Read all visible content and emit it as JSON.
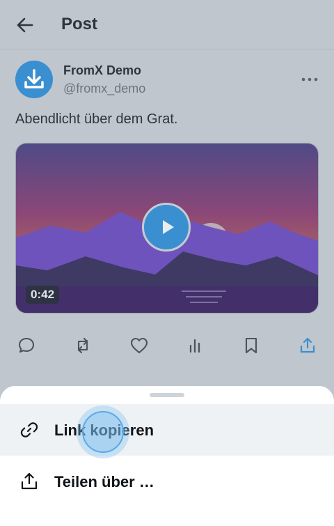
{
  "header": {
    "title": "Post",
    "back_icon": "arrow-left-icon"
  },
  "author": {
    "name": "FromX Demo",
    "handle": "@fromx_demo",
    "avatar_icon": "download-icon"
  },
  "post": {
    "text": "Abendlicht über dem Grat."
  },
  "video": {
    "duration": "0:42",
    "play_icon": "play-icon"
  },
  "actions": [
    {
      "name": "reply",
      "icon": "comment-icon"
    },
    {
      "name": "repost",
      "icon": "repost-icon"
    },
    {
      "name": "like",
      "icon": "heart-icon"
    },
    {
      "name": "views",
      "icon": "bar-chart-icon"
    },
    {
      "name": "bookmark",
      "icon": "bookmark-icon"
    },
    {
      "name": "share",
      "icon": "share-icon",
      "color": "#3a8fd0"
    }
  ],
  "sheet": {
    "items": [
      {
        "label": "Link kopieren",
        "icon": "link-icon"
      },
      {
        "label": "Teilen über …",
        "icon": "share-icon"
      }
    ]
  },
  "colors": {
    "accent": "#3a8fd0",
    "dimmed_background": "#bfc6cd"
  }
}
